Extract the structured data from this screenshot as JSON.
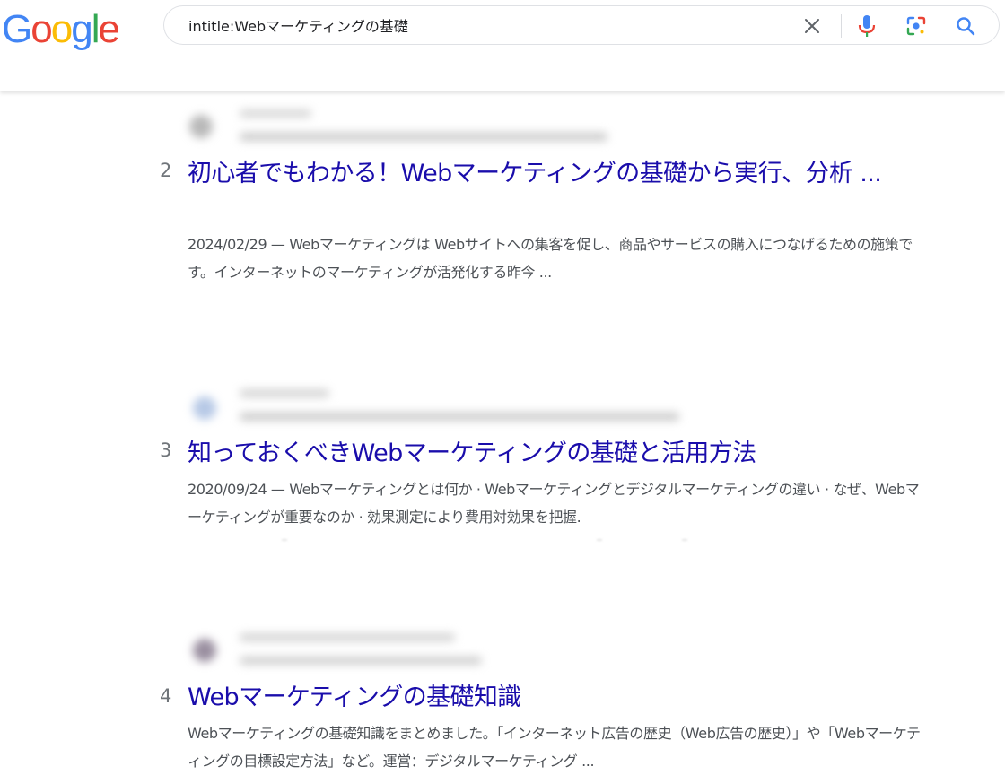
{
  "logo": {
    "text": "Google"
  },
  "search": {
    "query": "intitle:Webマーケティングの基礎"
  },
  "colors": {
    "title": "#1a0dab",
    "snippet": "#4d5156",
    "rank": "#70757a",
    "google_blue": "#4285F4",
    "google_red": "#EA4335",
    "google_yellow": "#FBBC05",
    "google_green": "#34A853"
  },
  "icons": {
    "clear": "close-icon",
    "voice": "microphone-icon",
    "lens": "camera-lens-icon",
    "search": "search-icon"
  },
  "results": [
    {
      "rank": "2",
      "title": "初心者でもわかる！Webマーケティングの基礎から実行、分析 ...",
      "snippet": "2024/02/29 — Webマーケティングは Webサイトへの集客を促し、商品やサービスの購入につなげるための施策です。インターネットのマーケティングが活発化する昨今 ..."
    },
    {
      "rank": "3",
      "title": "知っておくべきWebマーケティングの基礎と活用方法",
      "snippet": "2020/09/24 — Webマーケティングとは何か · Webマーケティングとデジタルマーケティングの違い · なぜ、Webマーケティングが重要なのか · 効果測定により費用対効果を把握."
    },
    {
      "rank": "4",
      "title": "Webマーケティングの基礎知識",
      "snippet": "Webマーケティングの基礎知識をまとめました。「インターネット広告の歴史（Web広告の歴史）」や「Webマーケティングの目標設定方法」など。運営：デジタルマーケティング ..."
    }
  ]
}
